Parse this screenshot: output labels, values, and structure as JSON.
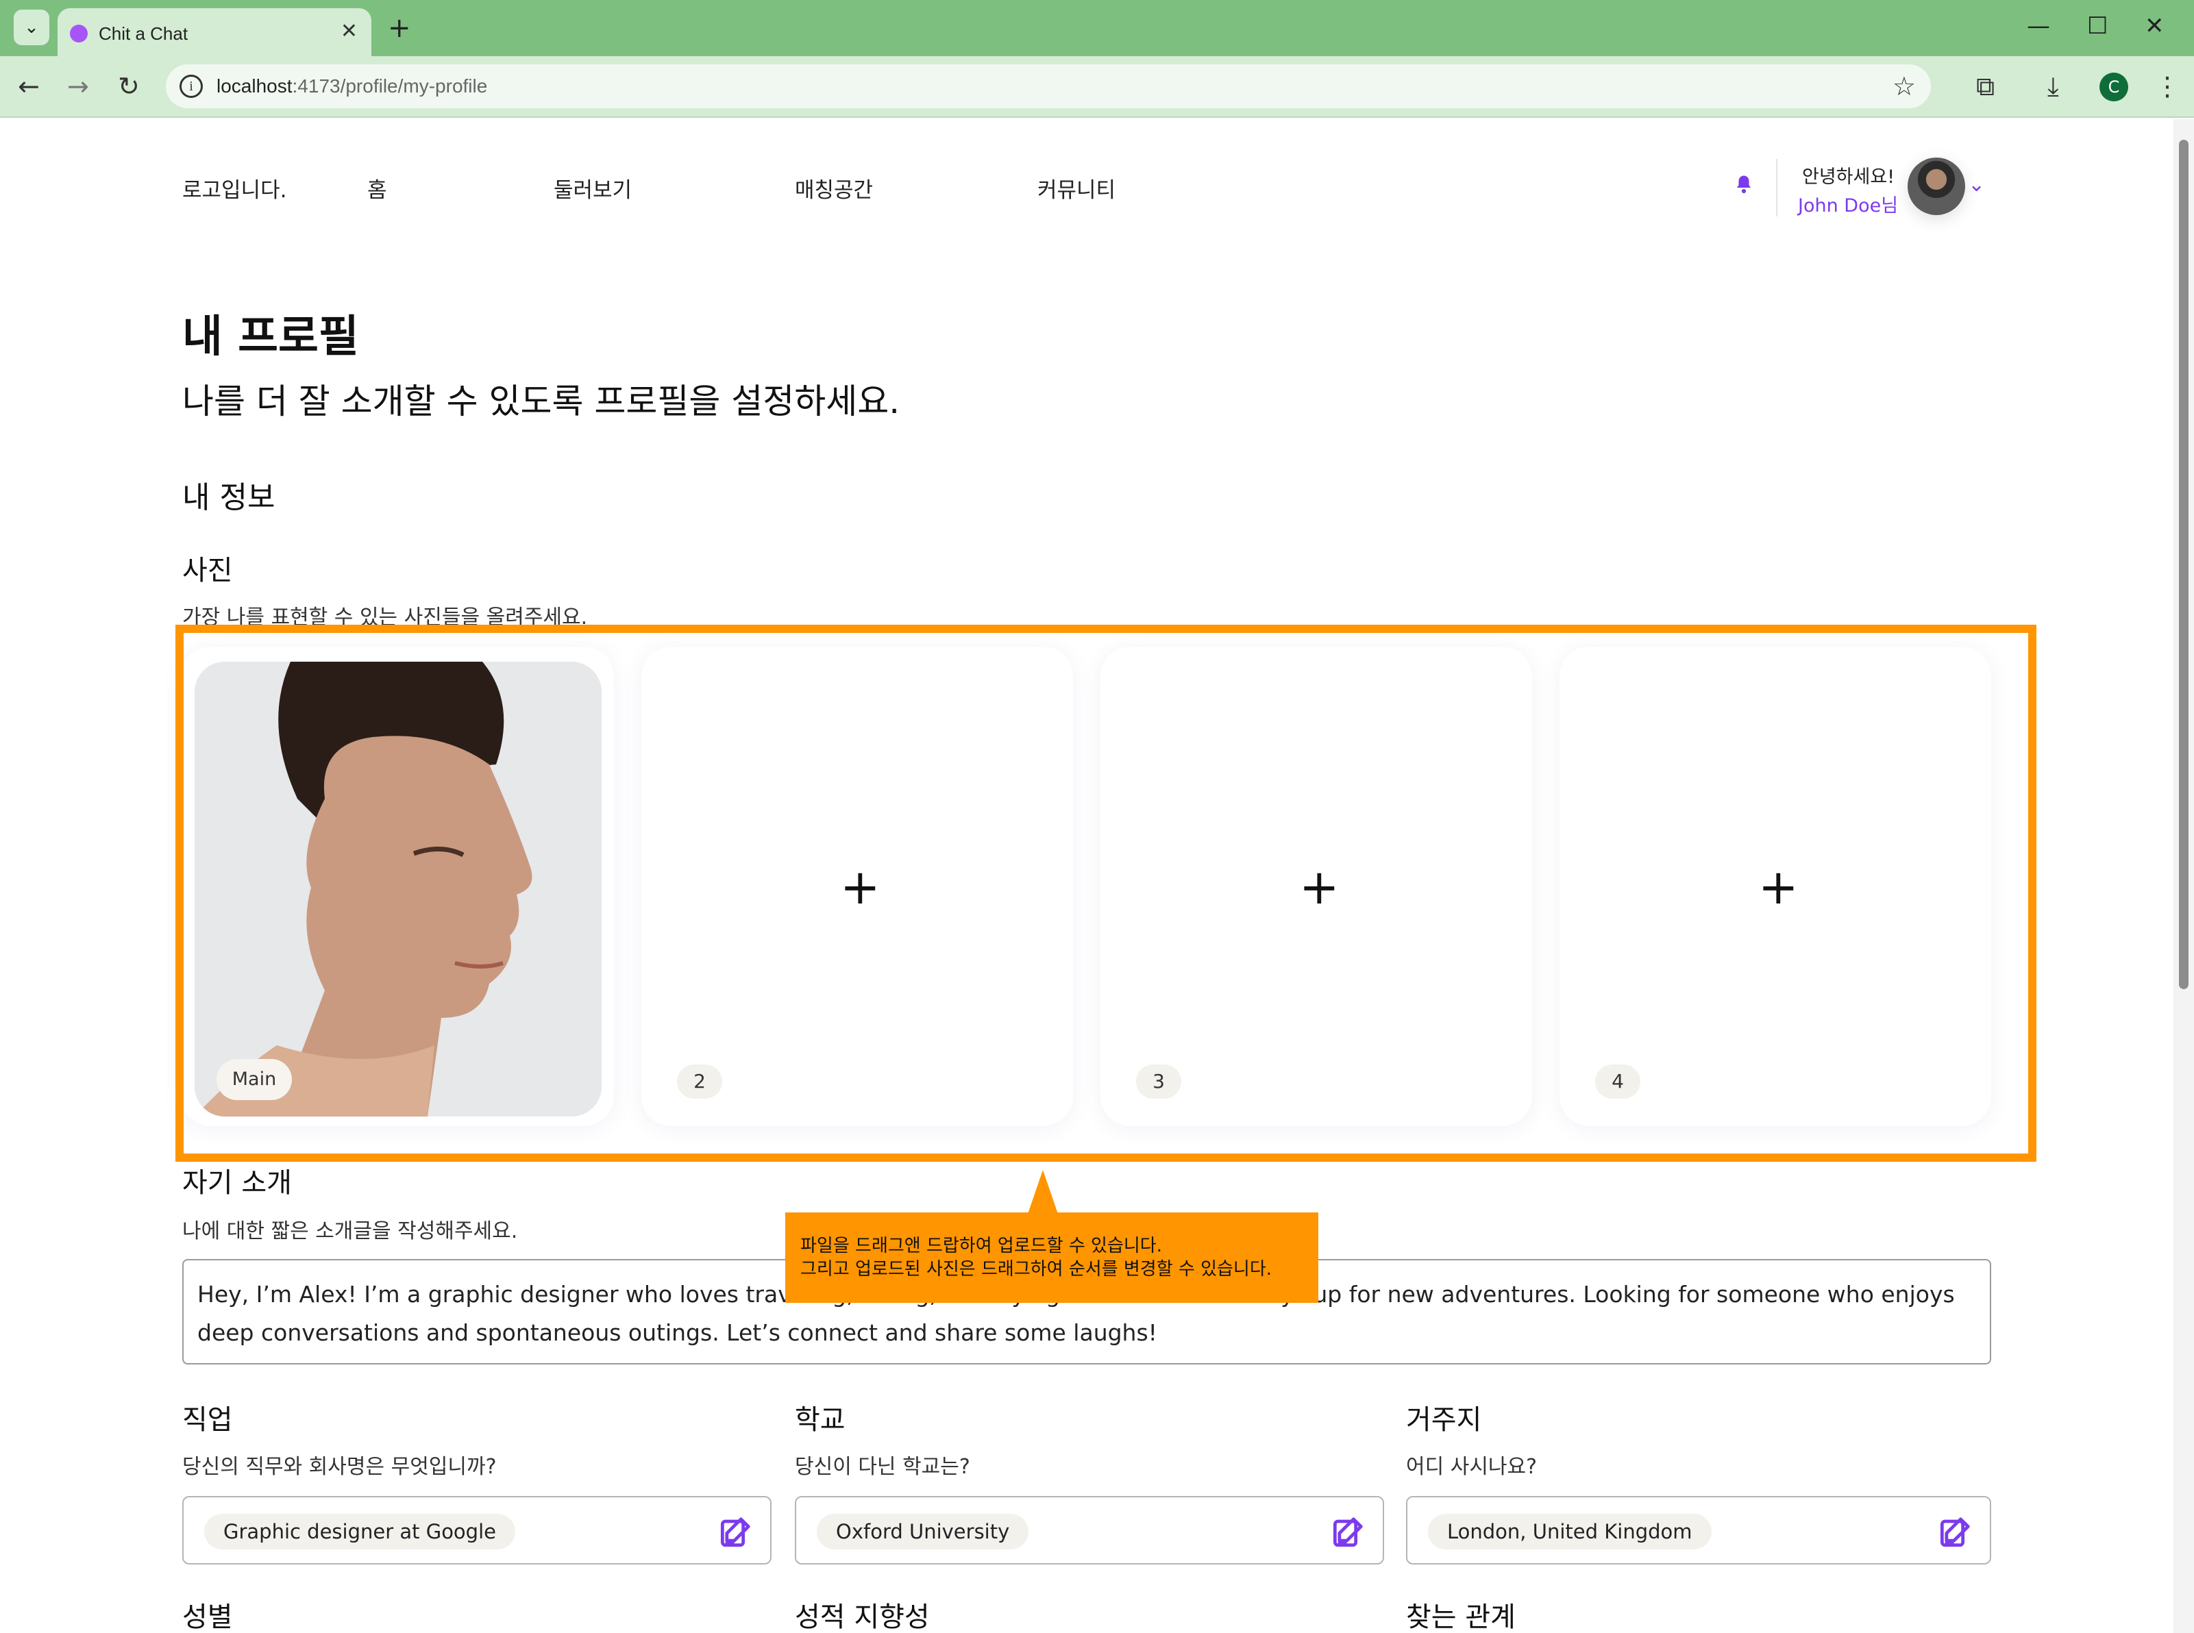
{
  "browser": {
    "tab_title": "Chit a Chat",
    "url_host": "localhost",
    "url_path": ":4173/profile/my-profile",
    "profile_initial": "C"
  },
  "header": {
    "logo": "로고입니다.",
    "nav": [
      "홈",
      "둘러보기",
      "매칭공간",
      "커뮤니티"
    ],
    "greeting": "안녕하세요!",
    "username": "John Doe님"
  },
  "page": {
    "title": "내 프로필",
    "subtitle": "나를 더 잘 소개할 수 있도록 프로필을 설정하세요.",
    "section": "내 정보"
  },
  "photos": {
    "title": "사진",
    "desc": "가장 나를 표현할 수 있는 사진들을 올려주세요.",
    "main_label": "Main",
    "slots": [
      "2",
      "3",
      "4"
    ],
    "add_symbol": "+"
  },
  "callout": {
    "line1": "파일을 드래그앤 드랍하여 업로드할 수 있습니다.",
    "line2": "그리고 업로드된 사진은 드래그하여 순서를 변경할 수 있습니다."
  },
  "intro": {
    "title": "자기 소개",
    "desc": "나에 대한 짧은 소개글을 작성해주세요.",
    "value": "Hey, I’m Alex! I’m a graphic designer who loves traveling, hiking, and trying new cuisines. Always up for new adventures. Looking for someone who enjoys deep conversations and spontaneous outings. Let’s connect and share some laughs!"
  },
  "fields": [
    {
      "title": "직업",
      "desc": "당신의 직무와 회사명은 무엇입니까?",
      "value": "Graphic designer at Google"
    },
    {
      "title": "학교",
      "desc": "당신이 다닌 학교는?",
      "value": "Oxford University"
    },
    {
      "title": "거주지",
      "desc": "어디 사시나요?",
      "value": "London, United Kingdom"
    }
  ],
  "next_fields": [
    "성별",
    "성적 지향성",
    "찾는 관계"
  ],
  "colors": {
    "accent": "#7c3aed",
    "highlight": "#ff9500"
  }
}
